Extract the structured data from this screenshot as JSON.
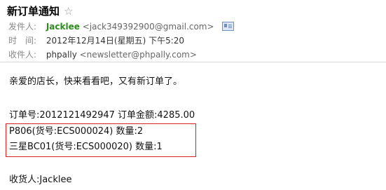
{
  "email": {
    "subject": "新订单通知",
    "star": "☆",
    "from_label": "发件人:",
    "from_name": "Jacklee",
    "from_addr": "<jack349392900@gmail.com>",
    "time_label": "时　间:",
    "time_value": "2012年12月14日(星期五) 下午5:20",
    "to_label": "收件人:",
    "to_name": "phpally",
    "to_addr": "<newsletter@phpally.com>"
  },
  "body": {
    "greeting": "亲爱的店长，快来看看吧，又有新订单了。",
    "order_line": "订单号:2012121492947 订单金额:4285.00",
    "items": [
      "P806(货号:ECS000024) 数量:2",
      "三星BC01(货号:ECS000020) 数量:1"
    ],
    "consignee": "收货人:Jacklee"
  }
}
